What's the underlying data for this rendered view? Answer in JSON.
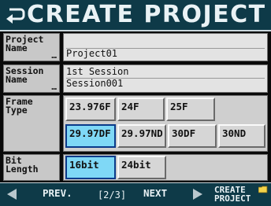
{
  "title": "CREATE PROJECT",
  "icons": {
    "back": "return-arrow-icon",
    "prev": "left-arrow-icon",
    "next": "right-arrow-icon",
    "create": "folder-icon"
  },
  "colors": {
    "accent": "#7fd8f6",
    "bar": "#0e3a48"
  },
  "project_name": {
    "label_line1": "Project",
    "label_line2": "Name",
    "dots": "…",
    "value": "Project01"
  },
  "session_name": {
    "label_line1": "Session",
    "label_line2": "Name",
    "dots": "…",
    "value_line1": "1st Session",
    "value_line2": "Session001"
  },
  "frame_type": {
    "label_line1": "Frame",
    "label_line2": "Type",
    "options": [
      "23.976F",
      "24F",
      "25F",
      "29.97DF",
      "29.97ND",
      "30DF",
      "30ND"
    ],
    "selected": "29.97DF"
  },
  "bit_length": {
    "label_line1": "Bit",
    "label_line2": "Length",
    "options": [
      "16bit",
      "24bit"
    ],
    "selected": "16bit"
  },
  "nav": {
    "prev": "PREV.",
    "page": "[2/3]",
    "next": "NEXT",
    "create_line1": "CREATE",
    "create_line2": "PROJECT"
  }
}
